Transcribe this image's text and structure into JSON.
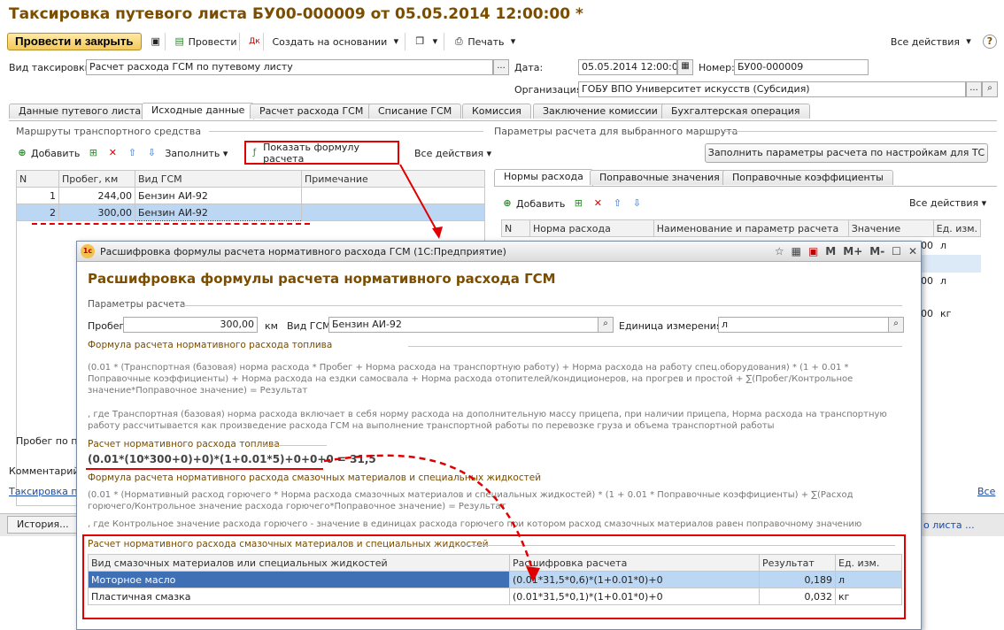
{
  "doc": {
    "title": "Таксировка путевого листа БУ00-000009 от 05.05.2014 12:00:00 *",
    "toolbar": {
      "post_close": "Провести и закрыть",
      "post": "Провести",
      "create_based": "Создать на основании",
      "print": "Печать",
      "all_actions": "Все действия",
      "help": "?"
    },
    "kind_label": "Вид таксировки:",
    "kind_value": "Расчет расхода ГСМ по путевому листу",
    "date_label": "Дата:",
    "date_value": "05.05.2014 12:00:00",
    "number_label": "Номер:",
    "number_value": "БУ00-000009",
    "org_label": "Организация:",
    "org_value": "ГОБУ ВПО Университет искусств (Субсидия)",
    "tabs": [
      "Данные путевого листа",
      "Исходные данные",
      "Расчет расхода ГСМ",
      "Списание ГСМ",
      "Комиссия",
      "Заключение комиссии",
      "Бухгалтерская операция"
    ],
    "routes": {
      "title": "Маршруты транспортного средства",
      "add": "Добавить",
      "fill": "Заполнить",
      "show_formula": "Показать формулу расчета",
      "all_actions": "Все действия",
      "columns": [
        "N",
        "Пробег, км",
        "Вид ГСМ",
        "Примечание"
      ],
      "rows": [
        {
          "n": "1",
          "mileage": "244,00",
          "fuel": "Бензин АИ-92",
          "note": ""
        },
        {
          "n": "2",
          "mileage": "300,00",
          "fuel": "Бензин АИ-92",
          "note": ""
        }
      ],
      "footer_mileage": "Пробег по п"
    },
    "params": {
      "title": "Параметры расчета для выбранного маршрута",
      "fill_btn": "Заполнить параметры расчета по настройкам для ТС",
      "tabs": [
        "Нормы расхода",
        "Поправочные значения",
        "Поправочные коэффициенты"
      ],
      "add": "Добавить",
      "all_actions": "Все действия",
      "columns": [
        "N",
        "Норма расхода",
        "Наименование и параметр расчета",
        "Значение",
        "Ед. изм."
      ],
      "units_visible": [
        "л",
        "л",
        "кг"
      ],
      "values_visible": [
        "00",
        "00",
        "00"
      ]
    },
    "comment_label": "Комментарий",
    "bottom_link": "Таксировка п",
    "bottom_all": "Все",
    "status": {
      "history": "История...",
      "right_text": "о листа ..."
    }
  },
  "dialog": {
    "window_title": "Расшифровка формулы расчета нормативного расхода ГСМ  (1С:Предприятие)",
    "heading": "Расшифровка формулы расчета нормативного расхода ГСМ",
    "params_section": "Параметры расчета",
    "mileage_label": "Пробег:",
    "mileage_value": "300,00",
    "km": "км",
    "fuel_label": "Вид ГСМ:",
    "fuel_value": "Бензин АИ-92",
    "unit_label": "Единица измерения:",
    "unit_value": "л",
    "fuel_formula_section": "Формула расчета нормативного расхода топлива",
    "fuel_formula_text": "(0.01 * (Транспортная (базовая) норма расхода * Пробег +  Норма расхода на транспортную работу) + Норма расхода на работу спец.оборудования) * (1 + 0.01 * Поправочные коэффициенты) + Норма расхода на ездки самосвала + Норма расхода отопителей/кондиционеров, на прогрев и простой + ∑(Пробег/Контрольное значение*Поправочное значение) = Результат",
    "fuel_formula_note": ", где Транспортная (базовая) норма расхода включает в себя норму расхода на дополнительную массу прицепа, при наличии прицепа, Норма расхода на транспортную работу рассчитывается как произведение расхода ГСМ на выполнение транспортной работы по перевозке груза и объема транспортной работы",
    "fuel_calc_section": "Расчет нормативного расхода топлива",
    "fuel_calc_value": "(0.01*(10*300+0)+0)*(1+0.01*5)+0+0+0 = 31,5",
    "lube_formula_section": "Формула расчета нормативного расхода смазочных материалов и специальных жидкостей",
    "lube_formula_text": "(0.01 * (Нормативный расход горючего * Норма расхода смазочных материалов и специальных жидкостей) * (1 + 0.01 * Поправочные коэффициенты) + ∑(Расход горючего/Контрольное значение расхода горючего*Поправочное значение) = Результат",
    "lube_formula_note": ", где Контрольное значение расхода горючего - значение в единицах расхода горючего при котором расход смазочных материалов равен поправочному значению",
    "lube_calc_section": "Расчет нормативного расхода смазочных материалов и специальных жидкостей",
    "lube_columns": [
      "Вид смазочных материалов или специальных жидкостей",
      "Расшифровка расчета",
      "Результат",
      "Ед. изм."
    ],
    "lube_rows": [
      {
        "kind": "Моторное масло",
        "calc": "(0.01*31,5*0,6)*(1+0.01*0)+0",
        "result": "0,189",
        "unit": "л"
      },
      {
        "kind": "Пластичная смазка",
        "calc": "(0.01*31,5*0,1)*(1+0.01*0)+0",
        "result": "0,032",
        "unit": "кг"
      }
    ],
    "ctrl": [
      "M",
      "M+",
      "M-"
    ]
  }
}
